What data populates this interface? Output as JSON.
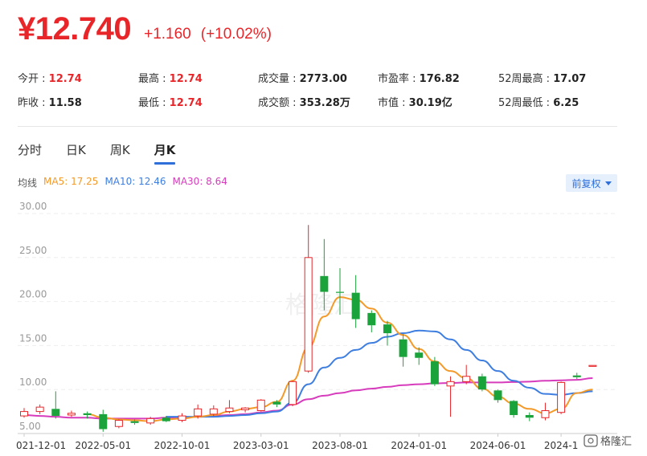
{
  "quote": {
    "price": "¥12.740",
    "change": "+1.160",
    "change_pct": "(+10.02%)"
  },
  "stats": [
    {
      "label": "今开 :",
      "value": "12.74",
      "tone": "red"
    },
    {
      "label": "最高 :",
      "value": "12.74",
      "tone": "red"
    },
    {
      "label": "成交量 :",
      "value": "2773.00",
      "tone": "dark"
    },
    {
      "label": "市盈率 :",
      "value": "176.82",
      "tone": "dark"
    },
    {
      "label": "52周最高 :",
      "value": "17.07",
      "tone": "dark"
    },
    {
      "label": "昨收 :",
      "value": "11.58",
      "tone": "dark"
    },
    {
      "label": "最低 :",
      "value": "12.74",
      "tone": "red"
    },
    {
      "label": "成交额 :",
      "value": "353.28万",
      "tone": "dark"
    },
    {
      "label": "市值 :",
      "value": "30.19亿",
      "tone": "dark"
    },
    {
      "label": "52周最低 :",
      "value": "6.25",
      "tone": "dark"
    }
  ],
  "tabs": [
    {
      "label": "分时",
      "active": false
    },
    {
      "label": "日K",
      "active": false
    },
    {
      "label": "周K",
      "active": false
    },
    {
      "label": "月K",
      "active": true
    }
  ],
  "ma_legend": {
    "title": "均线",
    "ma5": "MA5: 17.25",
    "ma10": "MA10: 12.46",
    "ma30": "MA30: 8.64"
  },
  "adjust_button": "前复权",
  "watermark": "格隆汇",
  "logo": "格隆汇",
  "colors": {
    "up": "#e8262a",
    "down": "#1aa33a",
    "ma5": "#f39a2a",
    "ma10": "#3d7ee0",
    "ma30": "#d63cbc",
    "accent": "#2e6fd9"
  },
  "chart_data": {
    "type": "candlestick",
    "y_ticks": [
      "30.00",
      "25.00",
      "20.00",
      "15.00",
      "10.00",
      "5.00"
    ],
    "ylim": [
      5,
      30
    ],
    "x_ticks": [
      {
        "label": "021-12-01",
        "index": 0
      },
      {
        "label": "2022-05-01",
        "index": 5
      },
      {
        "label": "2022-10-01",
        "index": 10
      },
      {
        "label": "2023-03-01",
        "index": 15
      },
      {
        "label": "2023-08-01",
        "index": 20
      },
      {
        "label": "2024-01-01",
        "index": 25
      },
      {
        "label": "2024-06-01",
        "index": 30
      },
      {
        "label": "2024-1",
        "index": 34
      }
    ],
    "candles": [
      {
        "o": 7.0,
        "c": 7.5,
        "h": 7.9,
        "l": 6.8
      },
      {
        "o": 7.5,
        "c": 8.0,
        "h": 8.3,
        "l": 7.2
      },
      {
        "o": 7.8,
        "c": 7.0,
        "h": 9.8,
        "l": 6.7
      },
      {
        "o": 7.1,
        "c": 7.3,
        "h": 7.6,
        "l": 6.9
      },
      {
        "o": 7.3,
        "c": 7.1,
        "h": 7.5,
        "l": 6.7
      },
      {
        "o": 7.2,
        "c": 5.5,
        "h": 7.7,
        "l": 5.2
      },
      {
        "o": 5.8,
        "c": 6.5,
        "h": 6.6,
        "l": 5.6
      },
      {
        "o": 6.4,
        "c": 6.2,
        "h": 6.6,
        "l": 6.0
      },
      {
        "o": 6.2,
        "c": 6.7,
        "h": 6.9,
        "l": 6.0
      },
      {
        "o": 6.8,
        "c": 6.4,
        "h": 7.0,
        "l": 6.3
      },
      {
        "o": 6.5,
        "c": 7.0,
        "h": 7.3,
        "l": 6.3
      },
      {
        "o": 7.0,
        "c": 7.8,
        "h": 8.3,
        "l": 6.7
      },
      {
        "o": 7.2,
        "c": 7.8,
        "h": 8.2,
        "l": 7.0
      },
      {
        "o": 7.5,
        "c": 7.9,
        "h": 8.8,
        "l": 7.3
      },
      {
        "o": 7.7,
        "c": 7.9,
        "h": 8.0,
        "l": 7.4
      },
      {
        "o": 7.6,
        "c": 8.8,
        "h": 8.9,
        "l": 7.5
      },
      {
        "o": 8.6,
        "c": 8.3,
        "h": 8.8,
        "l": 8.0
      },
      {
        "o": 8.3,
        "c": 10.9,
        "h": 11.0,
        "l": 8.1
      },
      {
        "o": 12.1,
        "c": 25.0,
        "h": 28.7,
        "l": 11.9
      },
      {
        "o": 22.9,
        "c": 21.1,
        "h": 27.1,
        "l": 19.0
      },
      {
        "o": 21.1,
        "c": 21.0,
        "h": 23.8,
        "l": 18.5
      },
      {
        "o": 21.0,
        "c": 18.0,
        "h": 23.0,
        "l": 17.0
      },
      {
        "o": 18.7,
        "c": 17.3,
        "h": 19.0,
        "l": 16.5
      },
      {
        "o": 17.4,
        "c": 16.4,
        "h": 17.8,
        "l": 15.0
      },
      {
        "o": 15.7,
        "c": 13.7,
        "h": 16.3,
        "l": 12.6
      },
      {
        "o": 14.2,
        "c": 13.6,
        "h": 14.8,
        "l": 12.8
      },
      {
        "o": 13.2,
        "c": 10.6,
        "h": 13.7,
        "l": 10.4
      },
      {
        "o": 10.4,
        "c": 10.9,
        "h": 11.5,
        "l": 6.9
      },
      {
        "o": 10.9,
        "c": 11.5,
        "h": 12.8,
        "l": 10.6
      },
      {
        "o": 11.5,
        "c": 10.0,
        "h": 11.8,
        "l": 9.8
      },
      {
        "o": 9.9,
        "c": 8.8,
        "h": 10.0,
        "l": 8.5
      },
      {
        "o": 8.7,
        "c": 7.1,
        "h": 8.8,
        "l": 6.8
      },
      {
        "o": 7.1,
        "c": 6.8,
        "h": 7.4,
        "l": 6.4
      },
      {
        "o": 6.8,
        "c": 7.6,
        "h": 8.5,
        "l": 6.5
      },
      {
        "o": 7.4,
        "c": 10.8,
        "h": 10.9,
        "l": 7.2
      },
      {
        "o": 11.6,
        "c": 11.4,
        "h": 11.9,
        "l": 11.2
      },
      {
        "o": 12.7,
        "c": 12.74,
        "h": 12.74,
        "l": 12.7
      }
    ],
    "ma5": [
      null,
      null,
      null,
      null,
      7.2,
      6.8,
      6.6,
      6.5,
      6.4,
      6.6,
      6.7,
      6.9,
      7.1,
      7.5,
      7.8,
      8.0,
      8.6,
      11.0,
      14.8,
      18.3,
      20.5,
      20.2,
      19.2,
      17.6,
      16.2,
      14.6,
      13.2,
      12.1,
      11.3,
      10.1,
      9.2,
      8.4,
      7.8,
      7.3,
      7.8,
      9.6,
      10.0
    ],
    "ma10": [
      null,
      null,
      null,
      null,
      null,
      null,
      null,
      null,
      null,
      6.9,
      6.9,
      6.9,
      6.9,
      7.0,
      7.1,
      7.3,
      7.5,
      8.5,
      10.6,
      12.5,
      13.6,
      14.5,
      15.3,
      16.0,
      16.4,
      16.7,
      16.6,
      15.7,
      14.5,
      13.3,
      12.1,
      11.0,
      10.2,
      9.5,
      9.4,
      9.6,
      9.8
    ],
    "ma30": [
      7.1,
      7.0,
      6.9,
      6.8,
      6.8,
      6.7,
      6.7,
      6.7,
      6.7,
      6.8,
      6.8,
      6.9,
      7.0,
      7.1,
      7.2,
      7.4,
      7.6,
      8.3,
      8.9,
      9.3,
      9.6,
      9.9,
      10.1,
      10.3,
      10.5,
      10.6,
      10.7,
      10.75,
      10.8,
      10.8,
      10.8,
      10.85,
      10.9,
      11.0,
      11.05,
      11.1,
      11.3
    ]
  }
}
